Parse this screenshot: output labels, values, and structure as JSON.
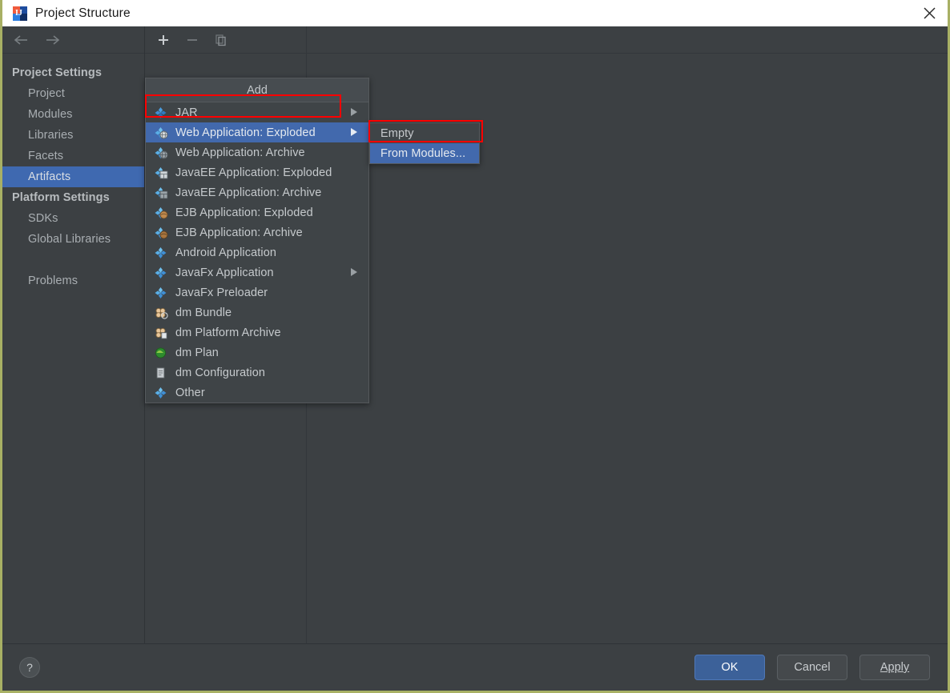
{
  "window": {
    "title": "Project Structure",
    "app_icon": "intellij-idea-icon",
    "close_icon": "close-icon"
  },
  "nav_toolbar": {
    "back_icon": "arrow-left-icon",
    "forward_icon": "arrow-right-icon"
  },
  "sidebar": {
    "groups": [
      {
        "label": "Project Settings",
        "items": [
          {
            "label": "Project",
            "selected": false
          },
          {
            "label": "Modules",
            "selected": false
          },
          {
            "label": "Libraries",
            "selected": false
          },
          {
            "label": "Facets",
            "selected": false
          },
          {
            "label": "Artifacts",
            "selected": true
          }
        ]
      },
      {
        "label": "Platform Settings",
        "items": [
          {
            "label": "SDKs",
            "selected": false
          },
          {
            "label": "Global Libraries",
            "selected": false
          }
        ]
      }
    ],
    "extra_items": [
      {
        "label": "Problems",
        "selected": false
      }
    ]
  },
  "artifacts_toolbar": {
    "add_icon": "plus-icon",
    "remove_icon": "minus-icon",
    "copy_icon": "copy-icon"
  },
  "add_menu": {
    "header": "Add",
    "items": [
      {
        "label": "JAR",
        "icon": "artifact-jar-icon",
        "has_submenu": true,
        "highlighted": false
      },
      {
        "label": "Web Application: Exploded",
        "icon": "artifact-web-exploded-icon",
        "has_submenu": true,
        "highlighted": true
      },
      {
        "label": "Web Application: Archive",
        "icon": "artifact-web-archive-icon",
        "has_submenu": false,
        "highlighted": false
      },
      {
        "label": "JavaEE Application: Exploded",
        "icon": "artifact-javaee-exploded-icon",
        "has_submenu": false,
        "highlighted": false
      },
      {
        "label": "JavaEE Application: Archive",
        "icon": "artifact-javaee-archive-icon",
        "has_submenu": false,
        "highlighted": false
      },
      {
        "label": "EJB Application: Exploded",
        "icon": "artifact-ejb-exploded-icon",
        "has_submenu": false,
        "highlighted": false
      },
      {
        "label": "EJB Application: Archive",
        "icon": "artifact-ejb-archive-icon",
        "has_submenu": false,
        "highlighted": false
      },
      {
        "label": "Android Application",
        "icon": "artifact-android-icon",
        "has_submenu": false,
        "highlighted": false
      },
      {
        "label": "JavaFx Application",
        "icon": "artifact-javafx-icon",
        "has_submenu": true,
        "highlighted": false
      },
      {
        "label": "JavaFx Preloader",
        "icon": "artifact-javafx-preloader-icon",
        "has_submenu": false,
        "highlighted": false
      },
      {
        "label": "dm Bundle",
        "icon": "dm-bundle-icon",
        "has_submenu": false,
        "highlighted": false
      },
      {
        "label": "dm Platform Archive",
        "icon": "dm-platform-archive-icon",
        "has_submenu": false,
        "highlighted": false
      },
      {
        "label": "dm Plan",
        "icon": "dm-plan-icon",
        "has_submenu": false,
        "highlighted": false
      },
      {
        "label": "dm Configuration",
        "icon": "dm-configuration-icon",
        "has_submenu": false,
        "highlighted": false
      },
      {
        "label": "Other",
        "icon": "artifact-other-icon",
        "has_submenu": false,
        "highlighted": false
      }
    ]
  },
  "submenu": {
    "items": [
      {
        "label": "Empty",
        "highlighted": false
      },
      {
        "label": "From Modules...",
        "highlighted": true
      }
    ]
  },
  "footer": {
    "help_label": "?",
    "ok_label": "OK",
    "cancel_label": "Cancel",
    "apply_label": "Apply"
  },
  "colors": {
    "accent_blue": "#4269ad",
    "selection_blue": "#3f69b0",
    "annotation_red": "#ff0000",
    "panel_bg": "#3c4043",
    "menu_bg": "#3f4447",
    "window_border": "#a8b064"
  }
}
